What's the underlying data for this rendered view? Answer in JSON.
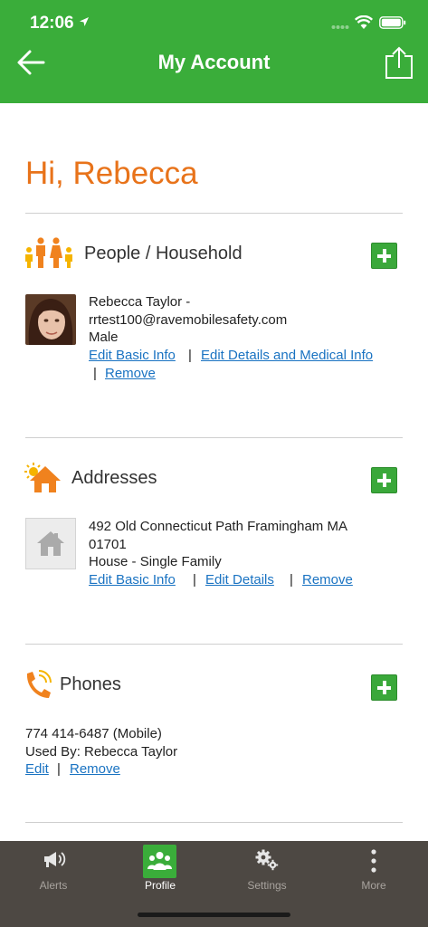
{
  "status_bar": {
    "time": "12:06"
  },
  "header": {
    "title": "My Account"
  },
  "greeting": "Hi, Rebecca",
  "people": {
    "title": "People / Household",
    "person": {
      "name_line": "Rebecca Taylor -",
      "email": "rrtest100@ravemobilesafety.com",
      "gender": "Male",
      "edit_basic": "Edit Basic Info",
      "edit_details": "Edit Details and Medical Info",
      "remove": "Remove",
      "separator": "|"
    }
  },
  "addresses": {
    "title": "Addresses",
    "address": {
      "line1": "492 Old Connecticut Path Framingham MA",
      "line2": "01701",
      "type": "House - Single Family",
      "edit_basic": "Edit Basic Info",
      "edit_details": "Edit Details",
      "remove": "Remove",
      "separator": "|"
    }
  },
  "phones": {
    "title": "Phones",
    "phone": {
      "number": "774 414-6487 (Mobile)",
      "used_by": "Used By: Rebecca Taylor",
      "edit": "Edit",
      "remove": "Remove",
      "separator": "|"
    }
  },
  "tabbar": {
    "tabs": [
      {
        "label": "Alerts",
        "icon": "megaphone-icon"
      },
      {
        "label": "Profile",
        "icon": "people-icon"
      },
      {
        "label": "Settings",
        "icon": "gears-icon"
      },
      {
        "label": "More",
        "icon": "more-vertical-icon"
      }
    ],
    "active": "Profile"
  },
  "colors": {
    "brand_green": "#3aad3a",
    "greeting_orange": "#e8731a",
    "link_blue": "#1a73c2",
    "tabbar_bg": "#4d4843"
  }
}
